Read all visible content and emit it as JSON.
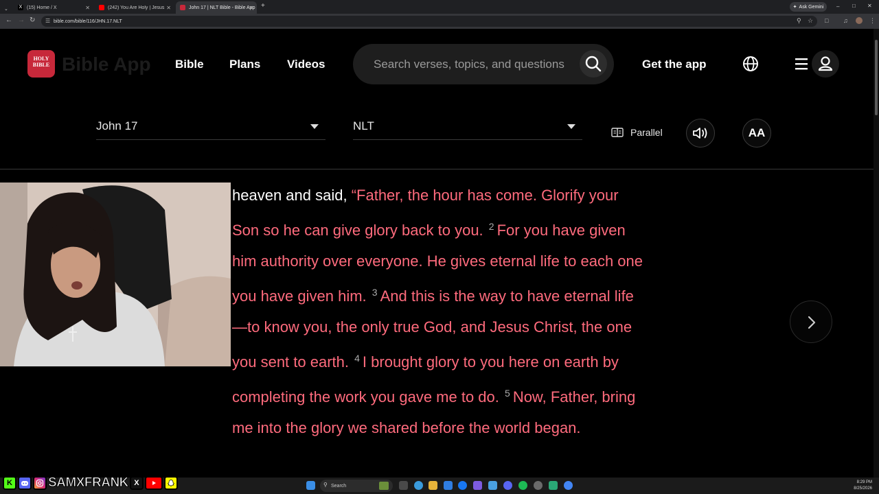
{
  "browser": {
    "tabs": [
      {
        "title": "(15) Home / X",
        "favicon_color": "#000000"
      },
      {
        "title": "(242) You Are Holy | Jesus Imag...",
        "favicon_color": "#ff0000"
      },
      {
        "title": "John 17 | NLT Bible - Bible App",
        "favicon_color": "#c7283a",
        "active": true
      }
    ],
    "new_tab_label": "+",
    "url": "bible.com/bible/116/JHN.17.NLT",
    "gemini_label": "Ask Gemini",
    "window_controls": [
      "–",
      "□",
      "✕"
    ]
  },
  "site": {
    "logo_text": "HOLY BIBLE",
    "brand": "Bible App",
    "nav": [
      "Bible",
      "Plans",
      "Videos"
    ],
    "search_placeholder": "Search verses, topics, and questions",
    "get_app": "Get the app"
  },
  "reader": {
    "book_chapter": "John 17",
    "version": "NLT",
    "parallel_label": "Parallel",
    "font_size_label": "AA",
    "passage": [
      {
        "type": "plain",
        "text": "heaven and said, "
      },
      {
        "type": "red",
        "text": "“Father, the hour has come. Glorify your Son so he can give glory back to you."
      },
      {
        "type": "verse",
        "text": "2"
      },
      {
        "type": "red",
        "text": "For you have given him authority over everyone. He gives eternal life to each one you have given him."
      },
      {
        "type": "verse",
        "text": "3"
      },
      {
        "type": "red",
        "text": "And this is the way to have eternal life—to know you, the only true God, and Jesus Christ, the one you sent to earth."
      },
      {
        "type": "verse",
        "text": "4"
      },
      {
        "type": "red",
        "text": "I brought glory to you here on earth by completing the work you gave me to do."
      },
      {
        "type": "verse",
        "text": "5"
      },
      {
        "type": "red",
        "text": "Now, Father, bring me into the glory we shared before the world began."
      }
    ],
    "words_of_christ_color": "#ff6b7d"
  },
  "stream_overlay": {
    "handle": "SAMXFRANK",
    "badges": [
      "K",
      "discord",
      "instagram",
      "x",
      "youtube",
      "snapchat"
    ]
  },
  "taskbar": {
    "search_label": "Search",
    "time": "8:29 PM",
    "date": "8/25/2026"
  }
}
